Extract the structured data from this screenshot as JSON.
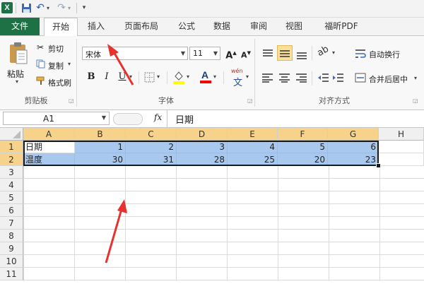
{
  "qat": {
    "logo": "X",
    "undo": "↶",
    "redo": "↷",
    "customize": "▾"
  },
  "tabs": {
    "file": "文件",
    "items": [
      "开始",
      "插入",
      "页面布局",
      "公式",
      "数据",
      "审阅",
      "视图",
      "福昕PDF"
    ]
  },
  "ribbon": {
    "clipboard": {
      "paste": "粘贴",
      "cut": "剪切",
      "copy": "复制",
      "format_painter": "格式刷",
      "group": "剪贴板"
    },
    "font": {
      "name": "宋体",
      "size": "11",
      "bold": "B",
      "italic": "I",
      "underline": "U",
      "group": "字体",
      "phonetic": "wén",
      "phonetic_char": "文"
    },
    "alignment": {
      "wrap": "自动换行",
      "merge": "合并后居中",
      "group": "对齐方式"
    }
  },
  "formula_bar": {
    "name_box": "A1",
    "fx": "fx",
    "value": "日期"
  },
  "sheet": {
    "columns": [
      "A",
      "B",
      "C",
      "D",
      "E",
      "F",
      "G",
      "H"
    ],
    "rows": [
      "1",
      "2",
      "3",
      "4",
      "5",
      "6",
      "7",
      "8",
      "9",
      "10",
      "11"
    ],
    "data": [
      [
        "日期",
        "1",
        "2",
        "3",
        "4",
        "5",
        "6"
      ],
      [
        "温度",
        "30",
        "31",
        "28",
        "25",
        "20",
        "23"
      ]
    ]
  },
  "colors": {
    "file_tab": "#1e7145",
    "selection": "#a9c8ee",
    "header_selected": "#f6d28a",
    "annotation": "#e8322e"
  }
}
